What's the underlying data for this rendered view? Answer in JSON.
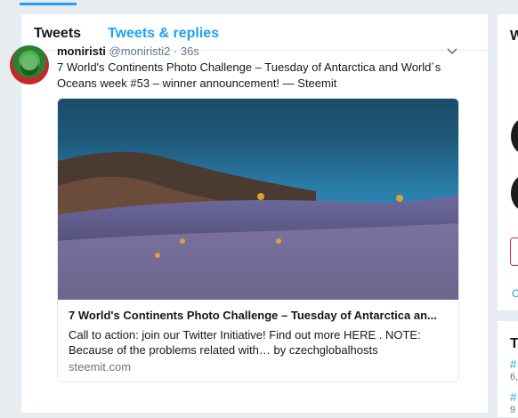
{
  "tabs": {
    "tweets": "Tweets",
    "tweets_replies": "Tweets & replies"
  },
  "tweet": {
    "name": "moniristi",
    "handle": "@moniristi2",
    "separator": " · ",
    "time": "36s",
    "text": "7 World's Continents Photo Challenge – Tuesday of Antarctica and World´s Oceans week #53 – winner announcement! — Steemit",
    "card": {
      "title": "7 World's Continents Photo Challenge – Tuesday of Antarctica an...",
      "description": "Call to action: join our Twitter Initiative! Find out more HERE . NOTE: Because of the problems related with… by czechglobalhosts",
      "domain": "steemit.com"
    }
  },
  "right_column": {
    "top_title": "W",
    "link_letter": "C",
    "bottom_title": "T",
    "hash1": "#",
    "sub1": "6,",
    "hash2": "#",
    "sub2": "9"
  },
  "colors": {
    "accent": "#1da1f2",
    "background": "#e6ecf0"
  },
  "icons": {
    "caret": "chevron-down-icon"
  }
}
